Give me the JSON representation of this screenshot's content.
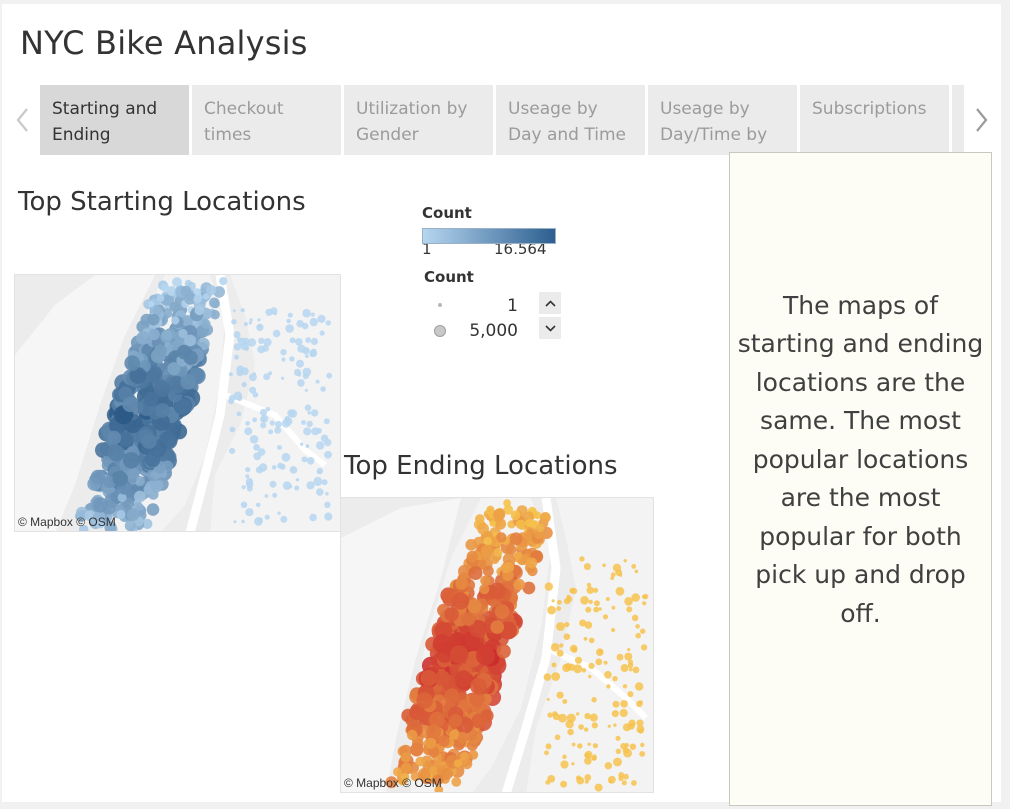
{
  "dashboard": {
    "title": "NYC Bike Analysis"
  },
  "tabs": [
    {
      "label": "Starting and Ending",
      "active": true
    },
    {
      "label": "Checkout times",
      "active": false
    },
    {
      "label": "Utilization by Gender",
      "active": false
    },
    {
      "label": "Useage by Day and Time",
      "active": false
    },
    {
      "label": "Useage by Day/Time by",
      "active": false
    },
    {
      "label": "Subscriptions",
      "active": false
    }
  ],
  "nav": {
    "prev_icon": "chevron-left-icon",
    "next_icon": "chevron-right-icon"
  },
  "start_map": {
    "title": "Top Starting Locations",
    "attribution": "© Mapbox © OSM",
    "color_low": "#b6d6f0",
    "color_high": "#1f4e7c"
  },
  "end_map": {
    "title": "Top Ending Locations",
    "attribution": "© Mapbox © OSM",
    "color_low": "#f6c24d",
    "color_high": "#c71f2c"
  },
  "legend_color": {
    "title": "Count",
    "min": "1",
    "max": "16,564"
  },
  "legend_size": {
    "title": "Count",
    "items": [
      {
        "label": "1"
      },
      {
        "label": "5,000"
      }
    ]
  },
  "note": {
    "text": "The maps of starting and ending locations are the same.  The most popular locations are the most popular for both pick up and drop off."
  }
}
